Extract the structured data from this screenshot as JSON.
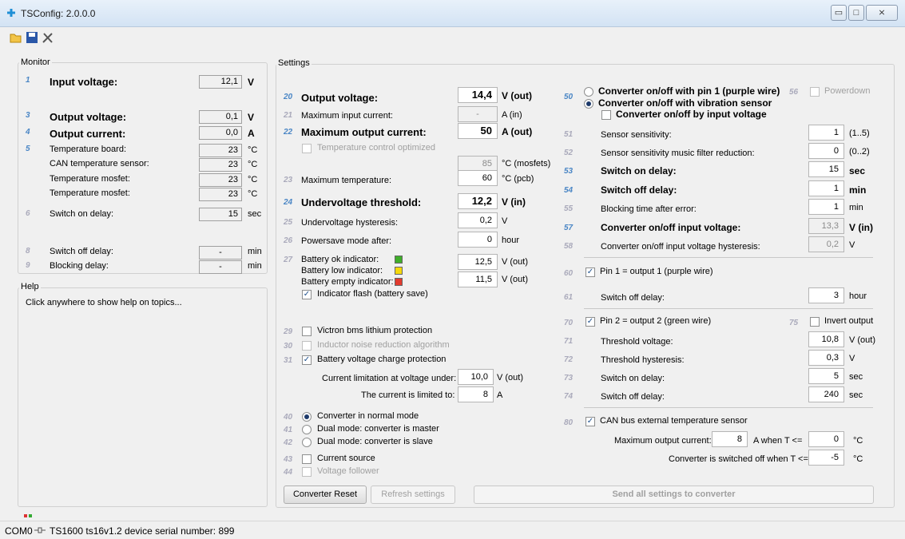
{
  "window": {
    "title": "TSConfig: 2.0.0.0",
    "minimize": "▭",
    "maximize": "□",
    "close": "⨯"
  },
  "monitor": {
    "title": "Monitor",
    "input_voltage": {
      "num": "1",
      "label": "Input voltage:",
      "value": "12,1",
      "unit": "V"
    },
    "output_voltage": {
      "num": "3",
      "label": "Output voltage:",
      "value": "0,1",
      "unit": "V"
    },
    "output_current": {
      "num": "4",
      "label": "Output current:",
      "value": "0,0",
      "unit": "A"
    },
    "temp_board": {
      "num": "5",
      "label": "Temperature board:",
      "value": "23",
      "unit": "°C"
    },
    "can_temp": {
      "label": "CAN temperature sensor:",
      "value": "23",
      "unit": "°C"
    },
    "temp_mosfet1": {
      "label": "Temperature mosfet:",
      "value": "23",
      "unit": "°C"
    },
    "temp_mosfet2": {
      "label": "Temperature mosfet:",
      "value": "23",
      "unit": "°C"
    },
    "switch_on_delay": {
      "num": "6",
      "label": "Switch on delay:",
      "value": "15",
      "unit": "sec"
    },
    "switch_off_delay": {
      "num": "8",
      "label": "Switch off delay:",
      "value": "-",
      "unit": "min"
    },
    "blocking_delay": {
      "num": "9",
      "label": "Blocking delay:",
      "value": "-",
      "unit": "min"
    }
  },
  "help": {
    "title": "Help",
    "text": "Click anywhere to show help on topics..."
  },
  "settings": {
    "title": "Settings",
    "s20": {
      "num": "20",
      "label": "Output voltage:",
      "value": "14,4",
      "unit": "V (out)"
    },
    "s21": {
      "num": "21",
      "label": "Maximum input current:",
      "value": "-",
      "unit": "A (in)"
    },
    "s22": {
      "num": "22",
      "label": "Maximum output current:",
      "value": "50",
      "unit": "A (out)"
    },
    "temp_ctrl": {
      "label": "Temperature control optimized"
    },
    "mosfet_temp": {
      "value": "85",
      "unit": "°C (mosfets)"
    },
    "s23": {
      "num": "23",
      "label": "Maximum temperature:",
      "value": "60",
      "unit": "°C (pcb)"
    },
    "s24": {
      "num": "24",
      "label": "Undervoltage threshold:",
      "value": "12,2",
      "unit": "V (in)"
    },
    "s25": {
      "num": "25",
      "label": "Undervoltage hysteresis:",
      "value": "0,2",
      "unit": "V"
    },
    "s26": {
      "num": "26",
      "label": "Powersave mode after:",
      "value": "0",
      "unit": "hour"
    },
    "s27": {
      "num": "27",
      "ok_label": "Battery ok indicator:",
      "ok_value": "12,5",
      "ok_unit": "V (out)",
      "low_label": "Battery low indicator:",
      "low_value": "11,5",
      "low_unit": "V (out)",
      "empty_label": "Battery empty indicator:",
      "flash_label": "Indicator flash (battery save)"
    },
    "colors": {
      "ok": "#3fae2a",
      "low": "#f5d80c",
      "empty": "#e23b2e"
    },
    "s29": {
      "num": "29",
      "label": "Victron bms lithium protection"
    },
    "s30": {
      "num": "30",
      "label": "Inductor noise reduction algorithm"
    },
    "s31": {
      "num": "31",
      "label": "Battery voltage charge protection"
    },
    "limit_voltage": {
      "label": "Current limitation at voltage under:",
      "value": "10,0",
      "unit": "V (out)"
    },
    "limit_current": {
      "label": "The current is limited to:",
      "value": "8",
      "unit": "A"
    },
    "s40": {
      "num": "40",
      "label": "Converter in normal mode"
    },
    "s41": {
      "num": "41",
      "label": "Dual mode: converter is master"
    },
    "s42": {
      "num": "42",
      "label": "Dual mode: converter is slave"
    },
    "s43": {
      "num": "43",
      "label": "Current source"
    },
    "s44": {
      "num": "44",
      "label": "Voltage follower"
    },
    "s50": {
      "num": "50",
      "pin1_label": "Converter on/off with pin 1 (purple wire)",
      "vib_label": "Converter on/off with vibration sensor",
      "input_label": "Converter on/off by input voltage"
    },
    "s56": {
      "num": "56",
      "label": "Powerdown"
    },
    "s51": {
      "num": "51",
      "label": "Sensor sensitivity:",
      "value": "1",
      "unit": "(1..5)"
    },
    "s52": {
      "num": "52",
      "label": "Sensor sensitivity music filter reduction:",
      "value": "0",
      "unit": "(0..2)"
    },
    "s53": {
      "num": "53",
      "label": "Switch on delay:",
      "value": "15",
      "unit": "sec"
    },
    "s54": {
      "num": "54",
      "label": "Switch off delay:",
      "value": "1",
      "unit": "min"
    },
    "s55": {
      "num": "55",
      "label": "Blocking time after error:",
      "value": "1",
      "unit": "min"
    },
    "s57": {
      "num": "57",
      "label": "Converter on/off input voltage:",
      "value": "13,3",
      "unit": "V (in)"
    },
    "s58": {
      "num": "58",
      "label": "Converter on/off input voltage hysteresis:",
      "value": "0,2",
      "unit": "V"
    },
    "s60": {
      "num": "60",
      "label": "Pin 1 = output 1 (purple wire)"
    },
    "s61": {
      "num": "61",
      "label": "Switch off delay:",
      "value": "3",
      "unit": "hour"
    },
    "s70": {
      "num": "70",
      "label": "Pin 2 = output 2 (green wire)"
    },
    "s75": {
      "num": "75",
      "label": "Invert output"
    },
    "s71": {
      "num": "71",
      "label": "Threshold voltage:",
      "value": "10,8",
      "unit": "V (out)"
    },
    "s72": {
      "num": "72",
      "label": "Threshold hysteresis:",
      "value": "0,3",
      "unit": "V"
    },
    "s73": {
      "num": "73",
      "label": "Switch on delay:",
      "value": "5",
      "unit": "sec"
    },
    "s74": {
      "num": "74",
      "label": "Switch off delay:",
      "value": "240",
      "unit": "sec"
    },
    "s80": {
      "num": "80",
      "label": "CAN bus external temperature sensor",
      "max_label": "Maximum output current:",
      "max_value": "8",
      "max_unit": "A  when T <=",
      "max_temp": "0",
      "temp_unit": "°C",
      "off_label": "Converter is switched off when T <=",
      "off_temp": "-5",
      "off_unit": "°C"
    }
  },
  "buttons": {
    "reset": "Converter Reset",
    "refresh": "Refresh settings",
    "send": "Send all settings to converter"
  },
  "status": {
    "port": "COM0",
    "text": "TS1600  ts16v1.2  device serial number: 899"
  }
}
